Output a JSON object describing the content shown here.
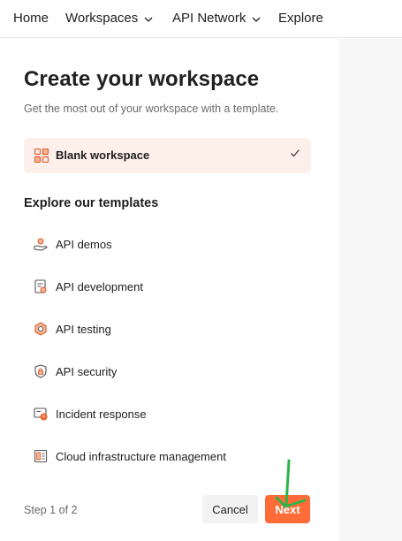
{
  "nav": {
    "home": "Home",
    "workspaces": "Workspaces",
    "api_network": "API Network",
    "explore": "Explore"
  },
  "main": {
    "title": "Create your workspace",
    "subtitle": "Get the most out of your workspace with a template.",
    "blank": {
      "label": "Blank workspace",
      "icon": "grid-icon",
      "selected": true
    },
    "section_title": "Explore our templates",
    "templates": [
      {
        "label": "API demos",
        "icon": "hand-demo-icon"
      },
      {
        "label": "API development",
        "icon": "document-code-icon"
      },
      {
        "label": "API testing",
        "icon": "hexagon-test-icon"
      },
      {
        "label": "API security",
        "icon": "lock-shield-icon"
      },
      {
        "label": "Incident response",
        "icon": "alert-monitor-icon"
      },
      {
        "label": "Cloud infrastructure management",
        "icon": "server-cloud-icon"
      }
    ]
  },
  "footer": {
    "step": "Step 1 of 2",
    "cancel": "Cancel",
    "next": "Next"
  },
  "colors": {
    "accent": "#ff6c37",
    "selected_bg": "#fdefe9",
    "annotation_arrow": "#2db34a"
  }
}
